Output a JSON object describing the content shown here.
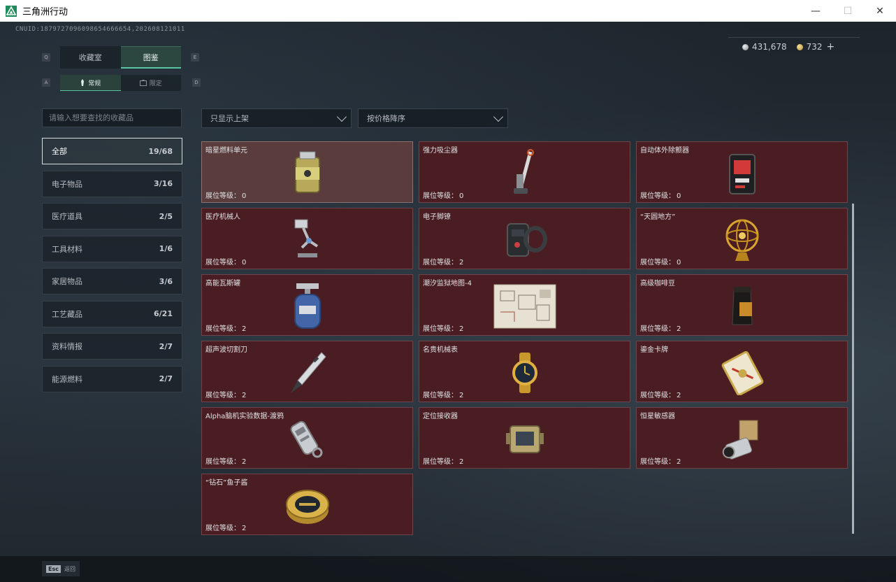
{
  "window": {
    "title": "三角洲行动",
    "minimize": "—",
    "maximize": "☐",
    "close": "✕"
  },
  "header": {
    "uid": "CNUID:1879727096098654666654,202608121011",
    "silver_amount": "431,678",
    "gold_amount": "732",
    "add_label": "+"
  },
  "tabs": {
    "key_left": "Q",
    "key_right": "E",
    "items": [
      {
        "label": "收藏室"
      },
      {
        "label": "图鉴"
      }
    ]
  },
  "subtabs": {
    "key_left": "A",
    "key_right": "D",
    "items": [
      {
        "label": "常规"
      },
      {
        "label": "限定"
      }
    ]
  },
  "search": {
    "placeholder": "请输入想要查找的收藏品"
  },
  "filters": {
    "display": "只显示上架",
    "sort": "按价格降序"
  },
  "categories": [
    {
      "label": "全部",
      "count": "19/68"
    },
    {
      "label": "电子物品",
      "count": "3/16"
    },
    {
      "label": "医疗道具",
      "count": "2/5"
    },
    {
      "label": "工具材料",
      "count": "1/6"
    },
    {
      "label": "家居物品",
      "count": "3/6"
    },
    {
      "label": "工艺藏品",
      "count": "6/21"
    },
    {
      "label": "资料情报",
      "count": "2/7"
    },
    {
      "label": "能源燃料",
      "count": "2/7"
    }
  ],
  "level_label": "展位等级：",
  "items": [
    {
      "name": "暗星燃料单元",
      "level": "0",
      "icon": "fuel-canister-icon"
    },
    {
      "name": "强力吸尘器",
      "level": "0",
      "icon": "vacuum-cleaner-icon"
    },
    {
      "name": "自动体外除颤器",
      "level": "0",
      "icon": "defibrillator-icon"
    },
    {
      "name": "医疗机械人",
      "level": "0",
      "icon": "medical-robot-icon"
    },
    {
      "name": "电子脚镣",
      "level": "2",
      "icon": "ankle-monitor-icon"
    },
    {
      "name": "“天圆地方”",
      "level": "0",
      "icon": "armillary-sphere-icon"
    },
    {
      "name": "高能瓦斯罐",
      "level": "2",
      "icon": "gas-tank-icon"
    },
    {
      "name": "潮汐监狱地图-4",
      "level": "2",
      "icon": "map-icon"
    },
    {
      "name": "高级咖啡豆",
      "level": "2",
      "icon": "coffee-bag-icon"
    },
    {
      "name": "超声波切割刀",
      "level": "2",
      "icon": "cutting-knife-icon"
    },
    {
      "name": "名贵机械表",
      "level": "2",
      "icon": "watch-icon"
    },
    {
      "name": "鎏金卡牌",
      "level": "2",
      "icon": "card-icon"
    },
    {
      "name": "Alpha脑机实验数据-渡鸦",
      "level": "2",
      "icon": "data-drive-icon"
    },
    {
      "name": "定位接收器",
      "level": "2",
      "icon": "receiver-icon"
    },
    {
      "name": "恒星敏感器",
      "level": "2",
      "icon": "star-sensor-icon"
    },
    {
      "name": "“钻石”鱼子酱",
      "level": "2",
      "icon": "caviar-tin-icon"
    }
  ],
  "footer": {
    "esc_key": "Esc",
    "esc_label": "返回"
  }
}
